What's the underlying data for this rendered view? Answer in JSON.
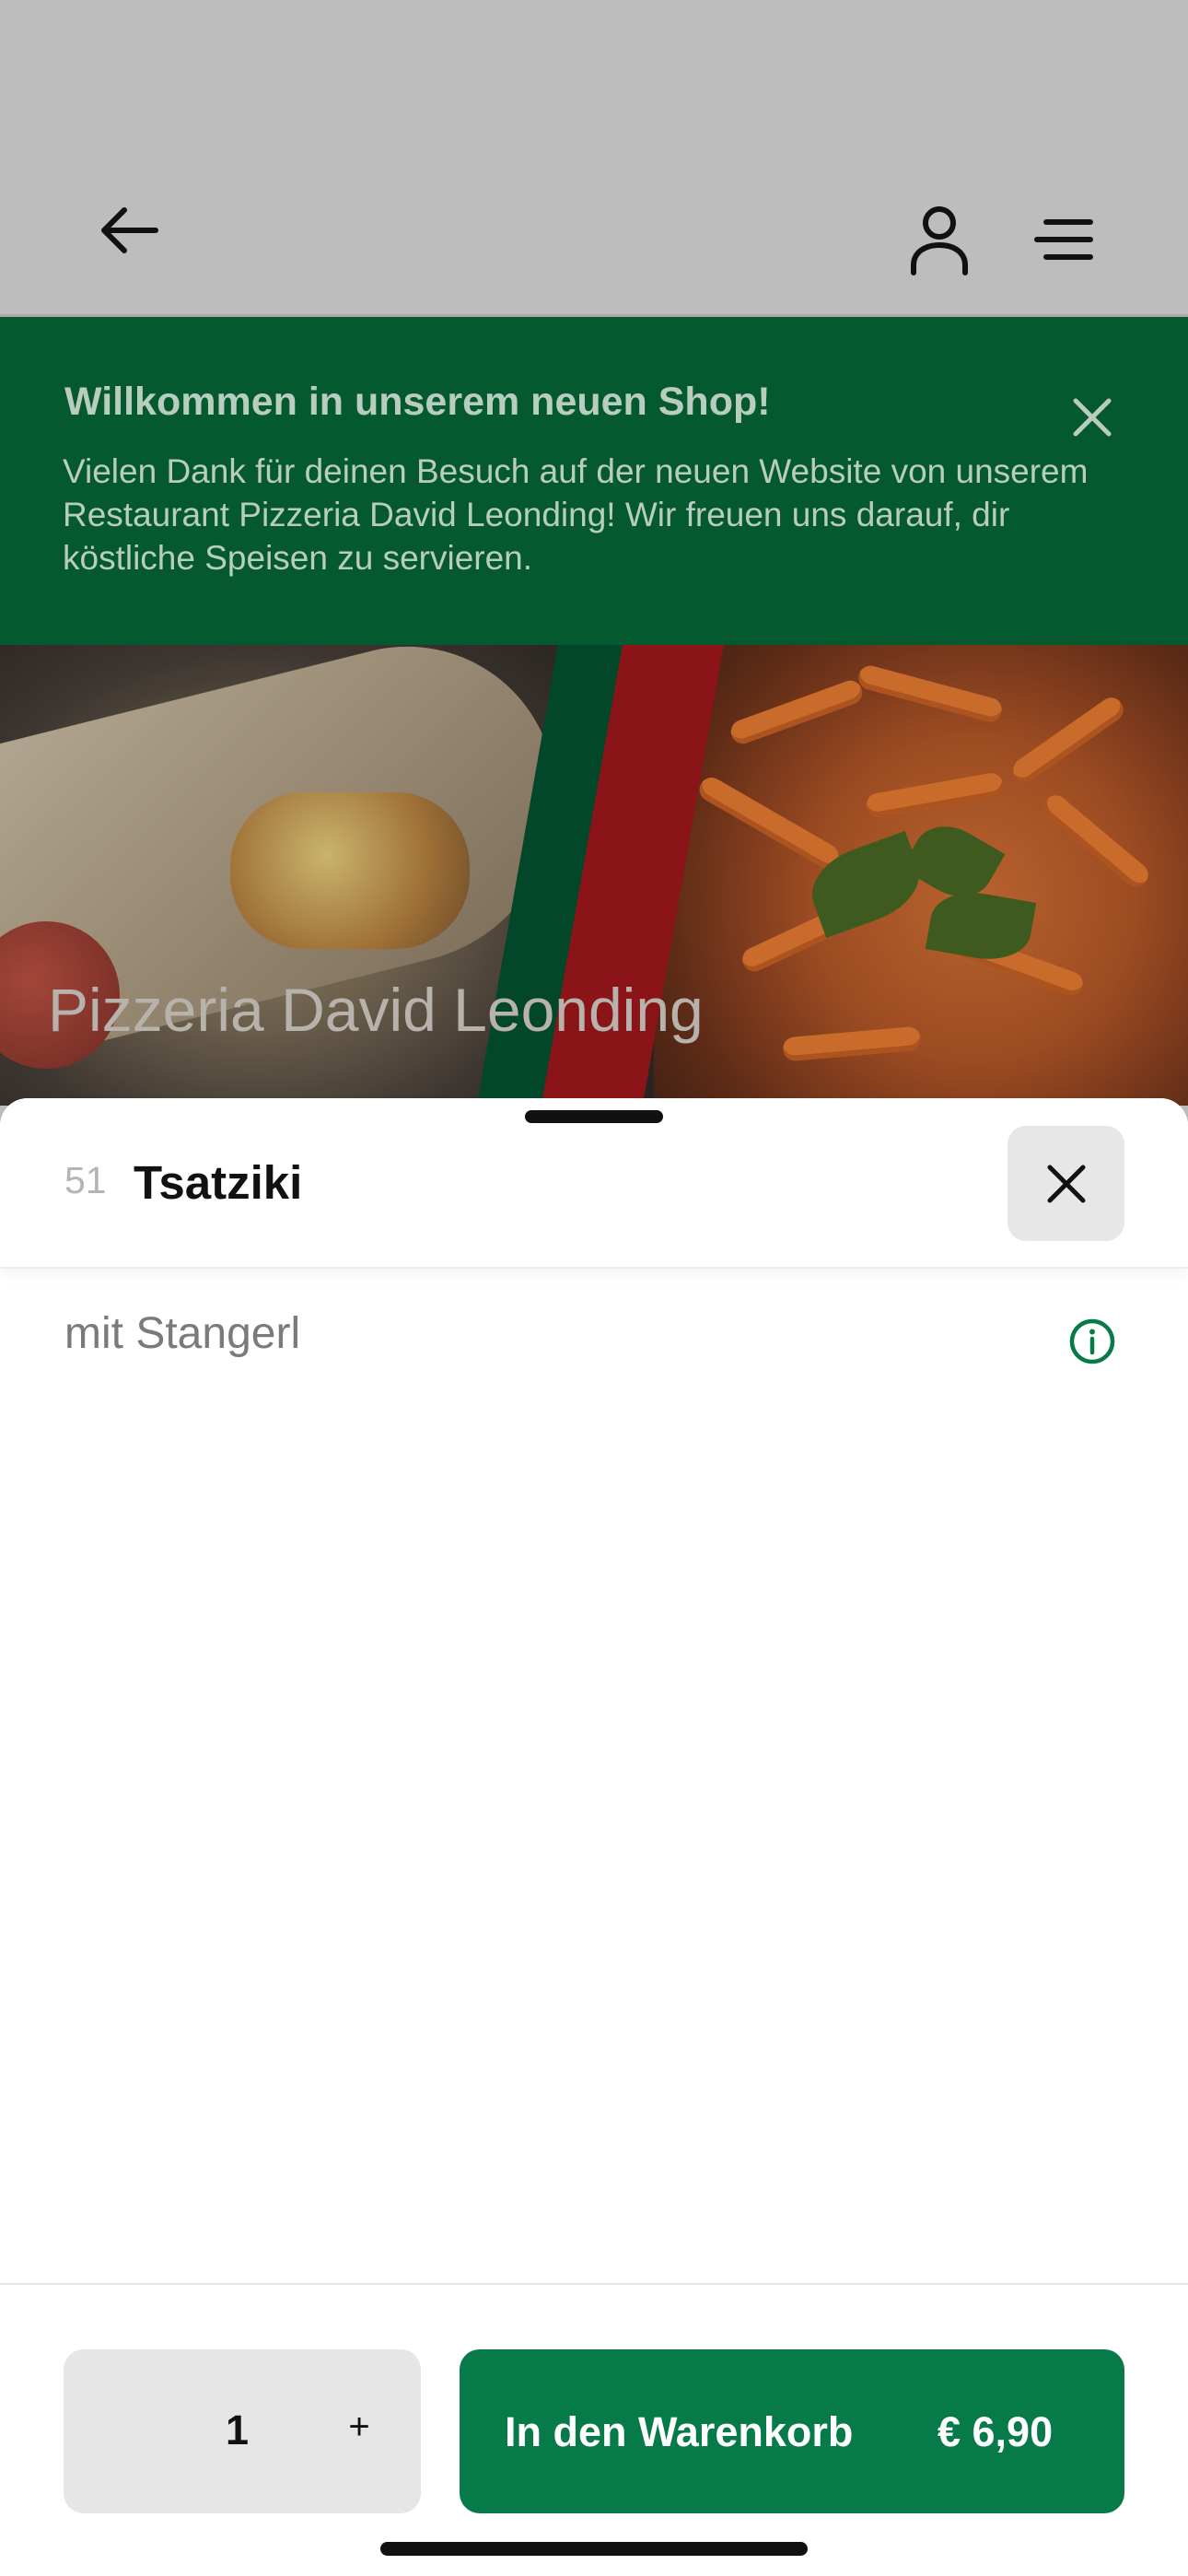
{
  "colors": {
    "brand_green": "#067a48",
    "banner_green": "#04592f",
    "overlay_gray": "#bdbdbd"
  },
  "header": {
    "back_icon": "arrow-left-icon",
    "account_icon": "user-icon",
    "menu_icon": "hamburger-menu-icon"
  },
  "banner": {
    "title": "Willkommen in unserem neuen Shop!",
    "text": "Vielen Dank für deinen Besuch auf der neuen Website von unserem Restaurant Pizzeria David Leonding! Wir freuen uns darauf, dir köstliche Speisen zu servieren.",
    "close_icon": "close-icon"
  },
  "hero": {
    "restaurant_name": "Pizzeria David Leonding"
  },
  "item": {
    "number": "51",
    "name": "Tsatziki",
    "description": "mit Stangerl",
    "info_icon": "info-icon",
    "close_icon": "close-icon"
  },
  "footer": {
    "quantity": "1",
    "plus_label": "+",
    "cart_label": "In den Warenkorb",
    "price": "€ 6,90"
  }
}
